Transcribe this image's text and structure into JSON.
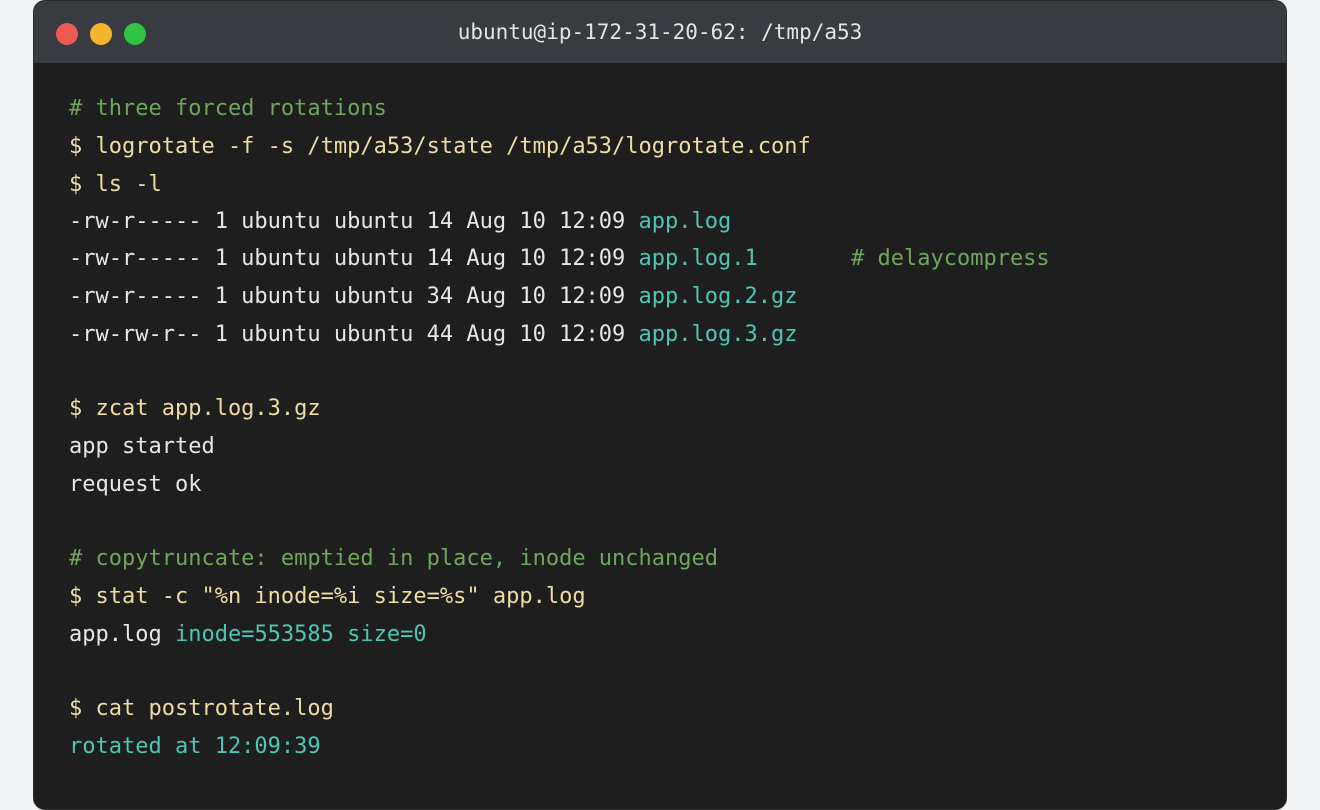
{
  "window": {
    "title": "ubuntu@ip-172-31-20-62: /tmp/a53"
  },
  "terminal": {
    "comment_forced": "# three forced rotations",
    "cmd_logrotate": "$ logrotate -f -s /tmp/a53/state /tmp/a53/logrotate.conf",
    "cmd_ls": "$ ls -l",
    "ls_rows": [
      {
        "meta": "-rw-r----- 1 ubuntu ubuntu 14 Aug 10 12:09 ",
        "name": "app.log",
        "note": ""
      },
      {
        "meta": "-rw-r----- 1 ubuntu ubuntu 14 Aug 10 12:09 ",
        "name": "app.log.1",
        "note": "# delaycompress"
      },
      {
        "meta": "-rw-r----- 1 ubuntu ubuntu 34 Aug 10 12:09 ",
        "name": "app.log.2.gz",
        "note": ""
      },
      {
        "meta": "-rw-rw-r-- 1 ubuntu ubuntu 44 Aug 10 12:09 ",
        "name": "app.log.3.gz",
        "note": ""
      }
    ],
    "cmd_zcat": "$ zcat app.log.3.gz",
    "zcat_out_1": "app started",
    "zcat_out_2": "request ok",
    "comment_copytruncate": "# copytruncate: emptied in place, inode unchanged",
    "cmd_stat": "$ stat -c \"%n inode=%i size=%s\" app.log",
    "stat_name": "app.log ",
    "stat_values": "inode=553585 size=0",
    "cmd_cat": "$ cat postrotate.log",
    "cat_out": "rotated at 12:09:39"
  },
  "colors": {
    "background": "#1e1e1e",
    "titlebar": "#383b3f",
    "comment": "#6ea65b",
    "command": "#ecdda3",
    "output": "#e6e6e6",
    "highlight": "#4ec6b1",
    "close": "#ee5a52",
    "minimize": "#f5b52c",
    "zoom": "#2fc441"
  }
}
